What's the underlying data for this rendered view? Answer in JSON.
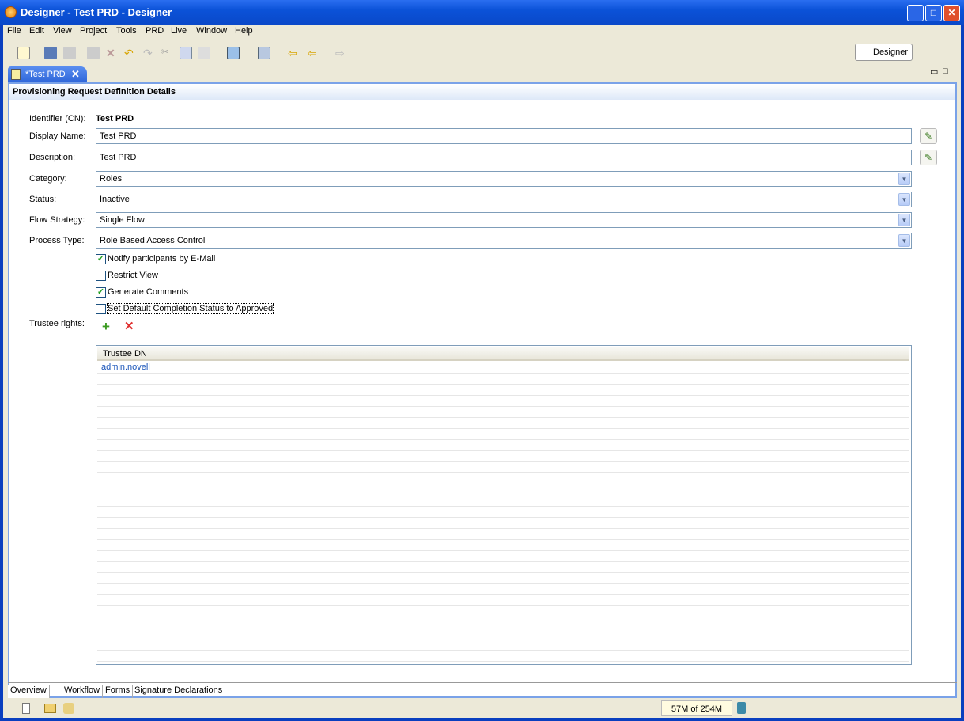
{
  "window": {
    "title": "Designer - Test PRD - Designer"
  },
  "menu": [
    "File",
    "Edit",
    "View",
    "Project",
    "Tools",
    "PRD",
    "Live",
    "Window",
    "Help"
  ],
  "perspective": {
    "label": "Designer"
  },
  "editor_tab": {
    "label": "*Test PRD"
  },
  "section": {
    "title": "Provisioning Request Definition Details"
  },
  "form": {
    "identifier_label": "Identifier (CN):",
    "identifier_value": "Test PRD",
    "display_name_label": "Display Name:",
    "display_name_value": "Test PRD",
    "description_label": "Description:",
    "description_value": "Test PRD",
    "category_label": "Category:",
    "category_value": "Roles",
    "status_label": "Status:",
    "status_value": "Inactive",
    "flow_label": "Flow Strategy:",
    "flow_value": "Single Flow",
    "process_label": "Process Type:",
    "process_value": "Role Based Access Control",
    "checkboxes": [
      {
        "label": "Notify participants by E-Mail",
        "checked": true
      },
      {
        "label": "Restrict View",
        "checked": false
      },
      {
        "label": "Generate Comments",
        "checked": true
      },
      {
        "label": "Set Default Completion Status to Approved",
        "checked": false
      }
    ],
    "trustee_label": "Trustee rights:"
  },
  "trustee_table": {
    "header": "Trustee DN",
    "rows": [
      "admin.novell"
    ]
  },
  "bottom_tabs": [
    "Overview",
    "Workflow",
    "Forms",
    "Signature Declarations"
  ],
  "status": {
    "memory": "57M of 254M"
  }
}
